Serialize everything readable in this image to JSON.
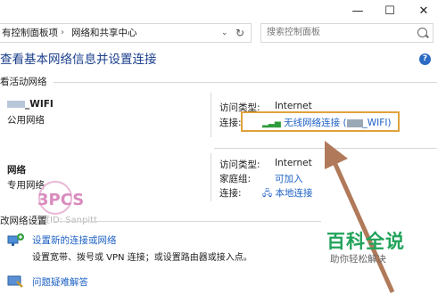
{
  "window": {
    "minimize_glyph": "—",
    "maximize_glyph": "☐",
    "close_glyph": "✕"
  },
  "address_bar": {
    "crumbs": [
      "有控制面板项",
      "网络和共享中心"
    ],
    "separator": "›",
    "search_placeholder": "搜索控制面板"
  },
  "page": {
    "title": "查看基本网络信息并设置连接",
    "active_networks_heading": "看活动网络"
  },
  "networks": [
    {
      "name_suffix": "_WIFI",
      "type": "公用网络",
      "access_type_label": "访问类型:",
      "access_type_value": "Internet",
      "connection_label": "连接:",
      "connection_value_prefix": "无线网络连接 (",
      "connection_value_suffix": "_WIFI)"
    },
    {
      "name": "网络",
      "type": "专用网络",
      "access_type_label": "访问类型:",
      "access_type_value": "Internet",
      "homegroup_label": "家庭组:",
      "homegroup_value": "可加入",
      "connection_label": "连接:",
      "connection_value": "本地连接"
    }
  ],
  "change_settings": {
    "heading": "改网络设置",
    "items": [
      {
        "title": "设置新的连接或网络",
        "desc": "设置宽带、拨号或 VPN 连接；或设置路由器或接入点。"
      },
      {
        "title": "问题疑难解答",
        "desc": ""
      }
    ]
  },
  "watermark": {
    "text": "百度ID: Sanpitt",
    "logo_letters": "3PCS"
  },
  "baike": {
    "title": "百科全说",
    "subtitle": "助你轻松解决"
  },
  "colors": {
    "link": "#1d61c4",
    "title": "#1a3e8c",
    "highlight": "#e0a23a",
    "arrow": "#b07a5a",
    "baike_green": "#21a35b"
  }
}
